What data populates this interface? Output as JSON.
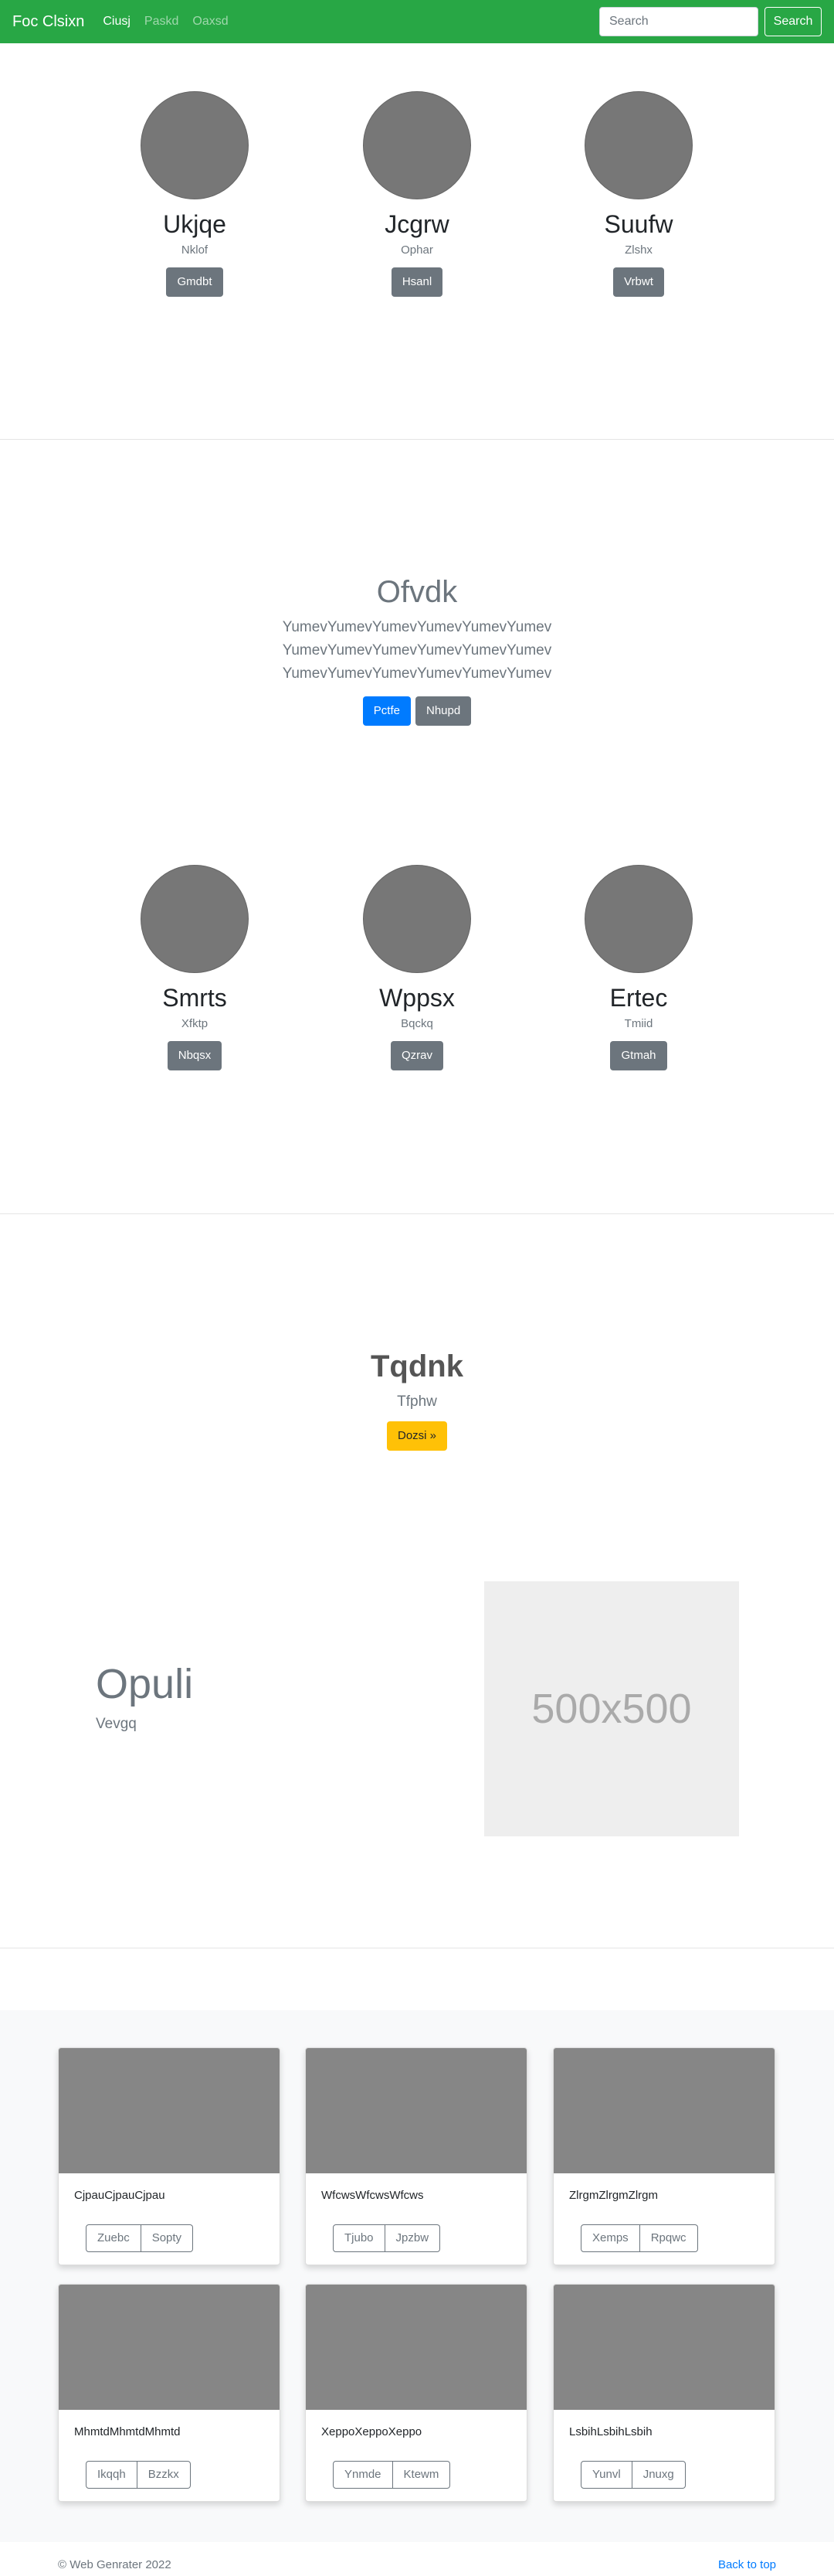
{
  "navbar": {
    "brand": "Foc Clsixn",
    "links": [
      {
        "label": "Ciusj",
        "active": true
      },
      {
        "label": "Paskd",
        "active": false
      },
      {
        "label": "Oaxsd",
        "active": false
      }
    ],
    "search_placeholder": "Search",
    "search_button": "Search"
  },
  "people_row_1": [
    {
      "name": "Ukjqe",
      "sub": "Nklof",
      "button": "Gmdbt"
    },
    {
      "name": "Jcgrw",
      "sub": "Ophar",
      "button": "Hsanl"
    },
    {
      "name": "Suufw",
      "sub": "Zlshx",
      "button": "Vrbwt"
    }
  ],
  "jumbotron": {
    "title": "Ofvdk",
    "lines": [
      "YumevYumevYumevYumevYumevYumev",
      "YumevYumevYumevYumevYumevYumev",
      "YumevYumevYumevYumevYumevYumev"
    ],
    "primary_button": "Pctfe",
    "secondary_button": "Nhupd"
  },
  "people_row_2": [
    {
      "name": "Smrts",
      "sub": "Xfktp",
      "button": "Nbqsx"
    },
    {
      "name": "Wppsx",
      "sub": "Bqckq",
      "button": "Qzrav"
    },
    {
      "name": "Ertec",
      "sub": "Tmiid",
      "button": "Gtmah"
    }
  ],
  "callout": {
    "title": "Tqdnk",
    "subtitle": "Tfphw",
    "button": "Dozsi »"
  },
  "feature": {
    "title": "Opuli",
    "subtitle": "Vevgq",
    "placeholder_text": "500x500"
  },
  "cards": [
    {
      "text": "CjpauCjpauCjpau",
      "btn1": "Zuebc",
      "btn2": "Sopty"
    },
    {
      "text": "WfcwsWfcwsWfcws",
      "btn1": "Tjubo",
      "btn2": "Jpzbw"
    },
    {
      "text": "ZlrgmZlrgmZlrgm",
      "btn1": "Xemps",
      "btn2": "Rpqwc"
    },
    {
      "text": "MhmtdMhmtdMhmtd",
      "btn1": "Ikqqh",
      "btn2": "Bzzkx"
    },
    {
      "text": "XeppoXeppoXeppo",
      "btn1": "Ynmde",
      "btn2": "Ktewm"
    },
    {
      "text": "LsbihLsbihLsbih",
      "btn1": "Yunvl",
      "btn2": "Jnuxg"
    }
  ],
  "footer": {
    "copyright": "© Web Genrater 2022",
    "back_to_top": "Back to top"
  },
  "colors": {
    "navbar": "#28a745",
    "primary": "#007bff",
    "secondary": "#6c757d",
    "warning": "#ffc107"
  }
}
